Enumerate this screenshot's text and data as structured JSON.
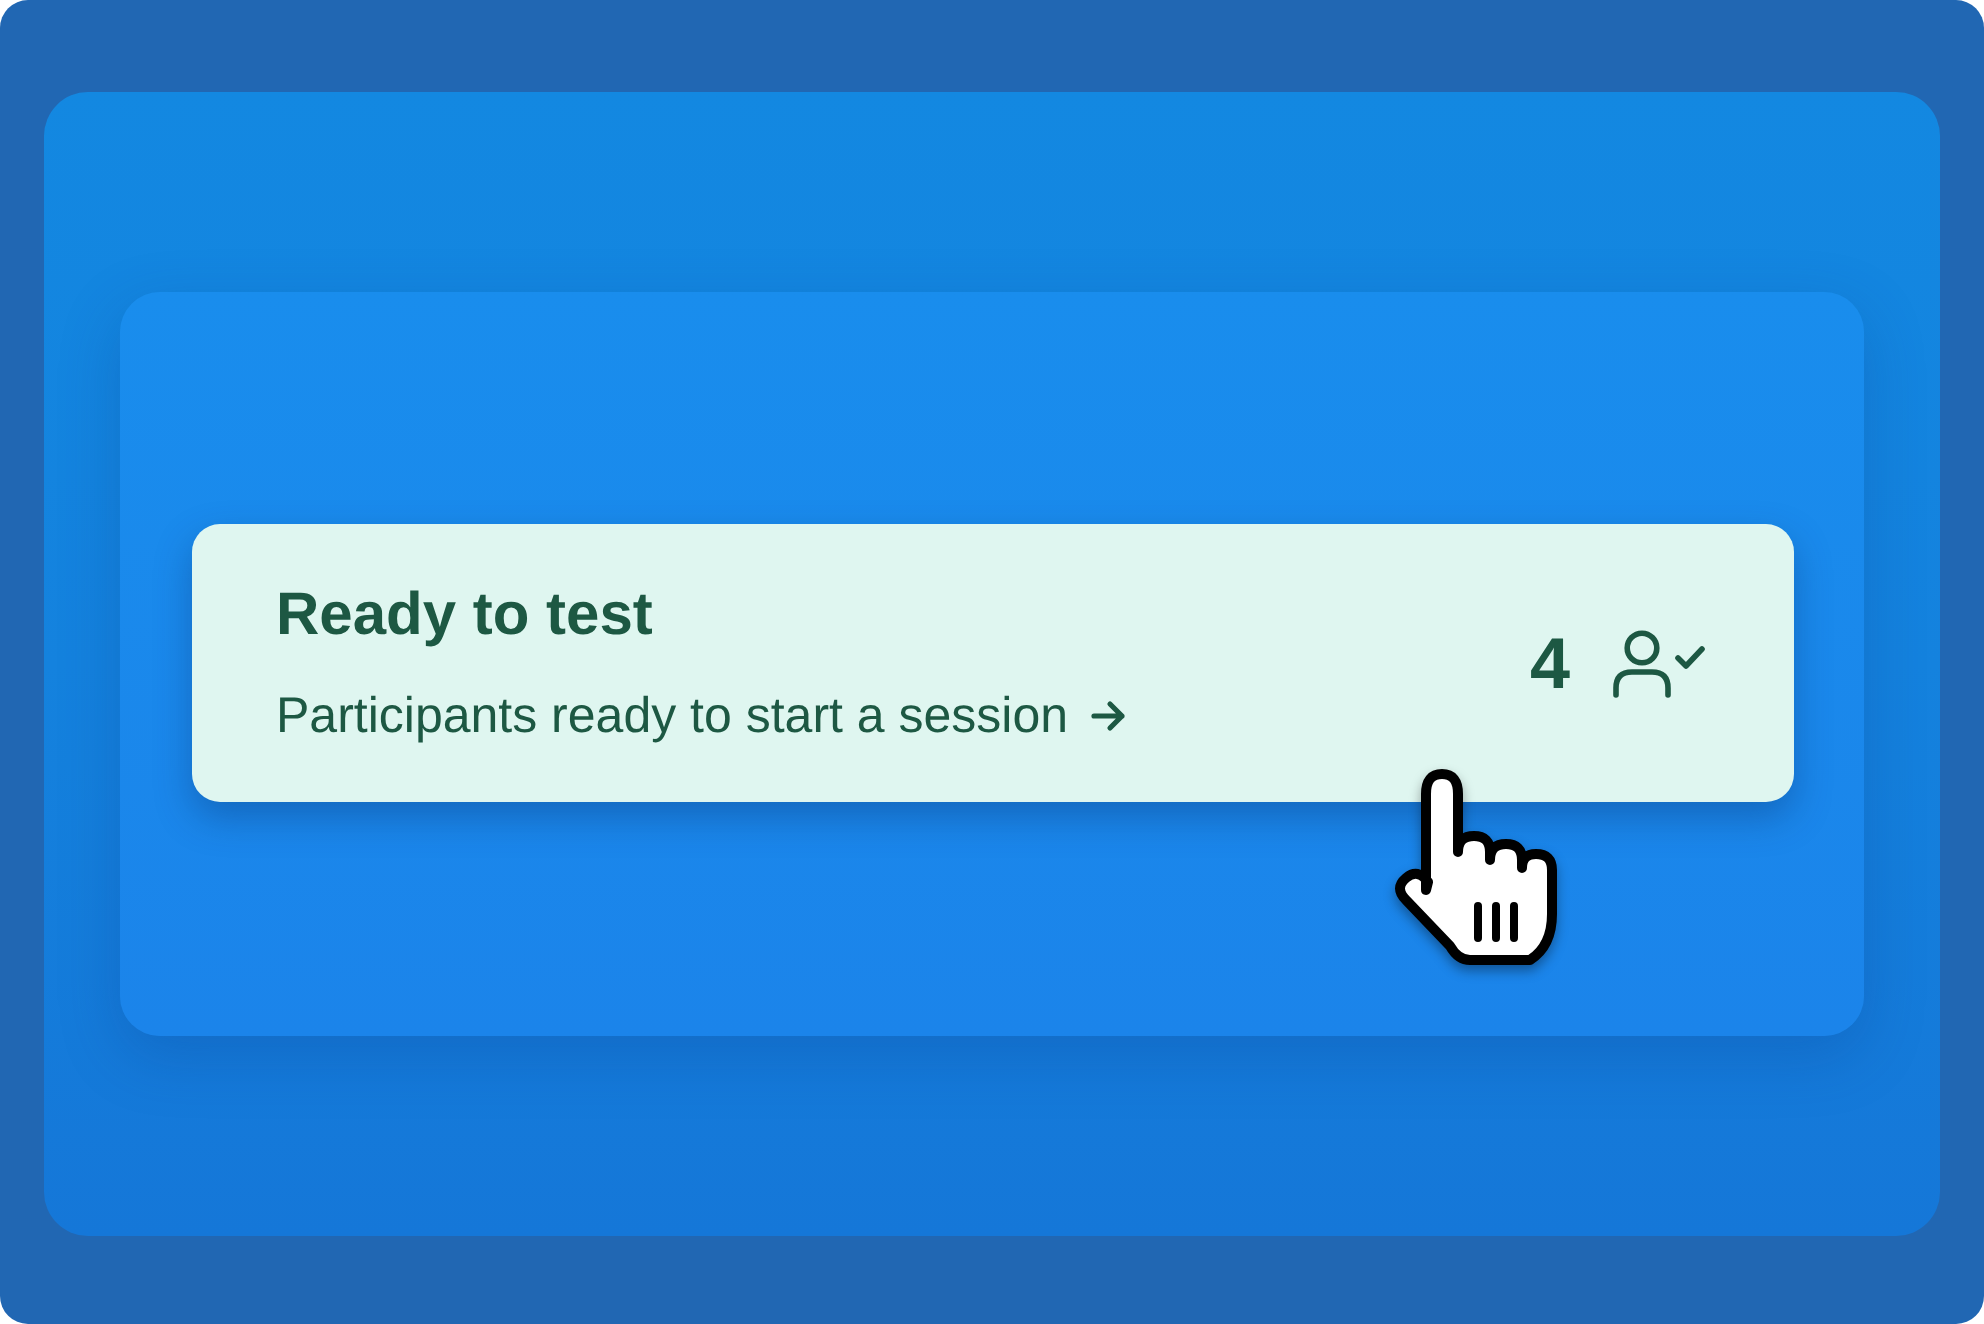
{
  "card": {
    "title": "Ready to test",
    "subtitle": "Participants ready to start a session",
    "count": "4"
  }
}
